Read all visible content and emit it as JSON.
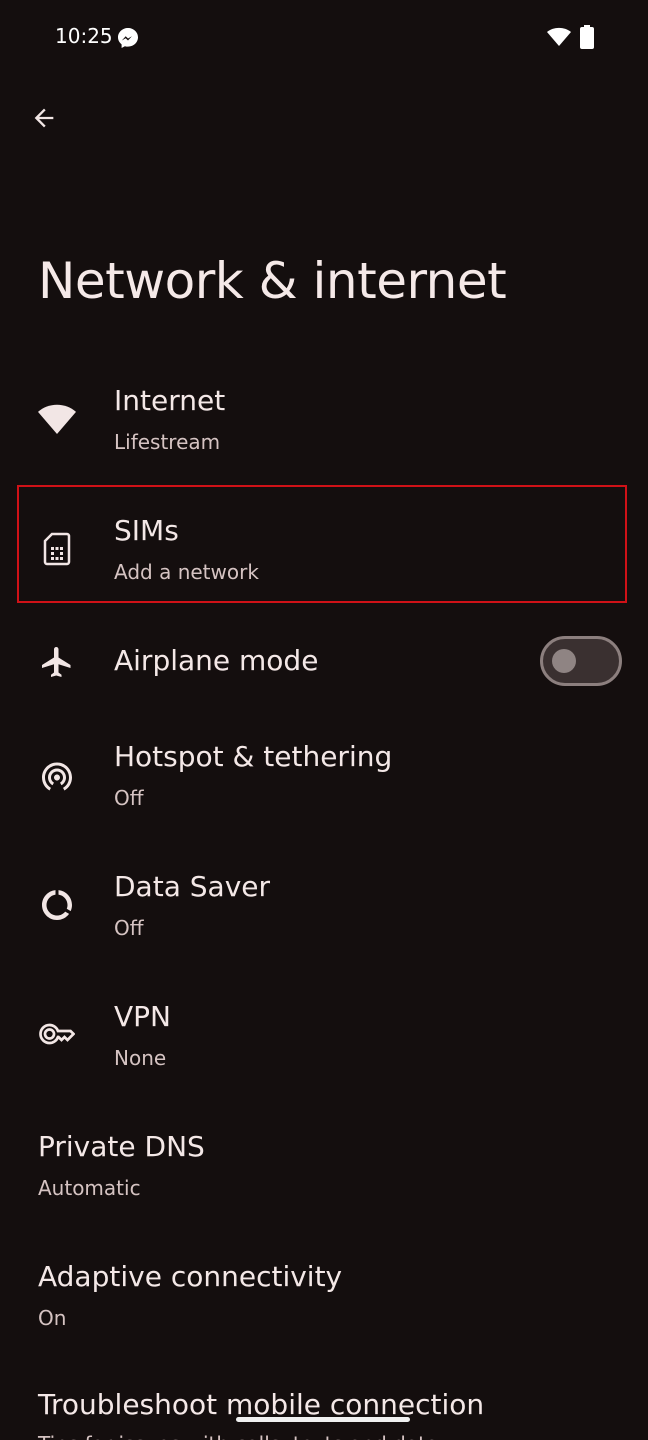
{
  "status_bar": {
    "time": "10:25",
    "icons": [
      "messenger-icon",
      "wifi-icon",
      "battery-icon"
    ]
  },
  "header": {
    "back_icon": "arrow-left-icon",
    "title": "Network & internet"
  },
  "items": [
    {
      "id": "internet",
      "icon": "wifi-icon",
      "title": "Internet",
      "subtitle": "Lifestream"
    },
    {
      "id": "sims",
      "icon": "sim-card-icon",
      "title": "SIMs",
      "subtitle": "Add a network",
      "highlighted": true
    },
    {
      "id": "airplane",
      "icon": "airplane-icon",
      "title": "Airplane mode",
      "toggle": "off"
    },
    {
      "id": "hotspot",
      "icon": "hotspot-icon",
      "title": "Hotspot & tethering",
      "subtitle": "Off"
    },
    {
      "id": "data_saver",
      "icon": "data-saver-icon",
      "title": "Data Saver",
      "subtitle": "Off"
    },
    {
      "id": "vpn",
      "icon": "vpn-key-icon",
      "title": "VPN",
      "subtitle": "None"
    },
    {
      "id": "private_dns",
      "title": "Private DNS",
      "subtitle": "Automatic"
    },
    {
      "id": "adaptive",
      "title": "Adaptive connectivity",
      "subtitle": "On"
    },
    {
      "id": "troubleshoot",
      "title": "Troubleshoot mobile connection",
      "subtitle": "Tips for issues with calls, texts and data"
    }
  ],
  "colors": {
    "background": "#140e0e",
    "text": "#f2e6e5",
    "highlight": "#d01117"
  }
}
